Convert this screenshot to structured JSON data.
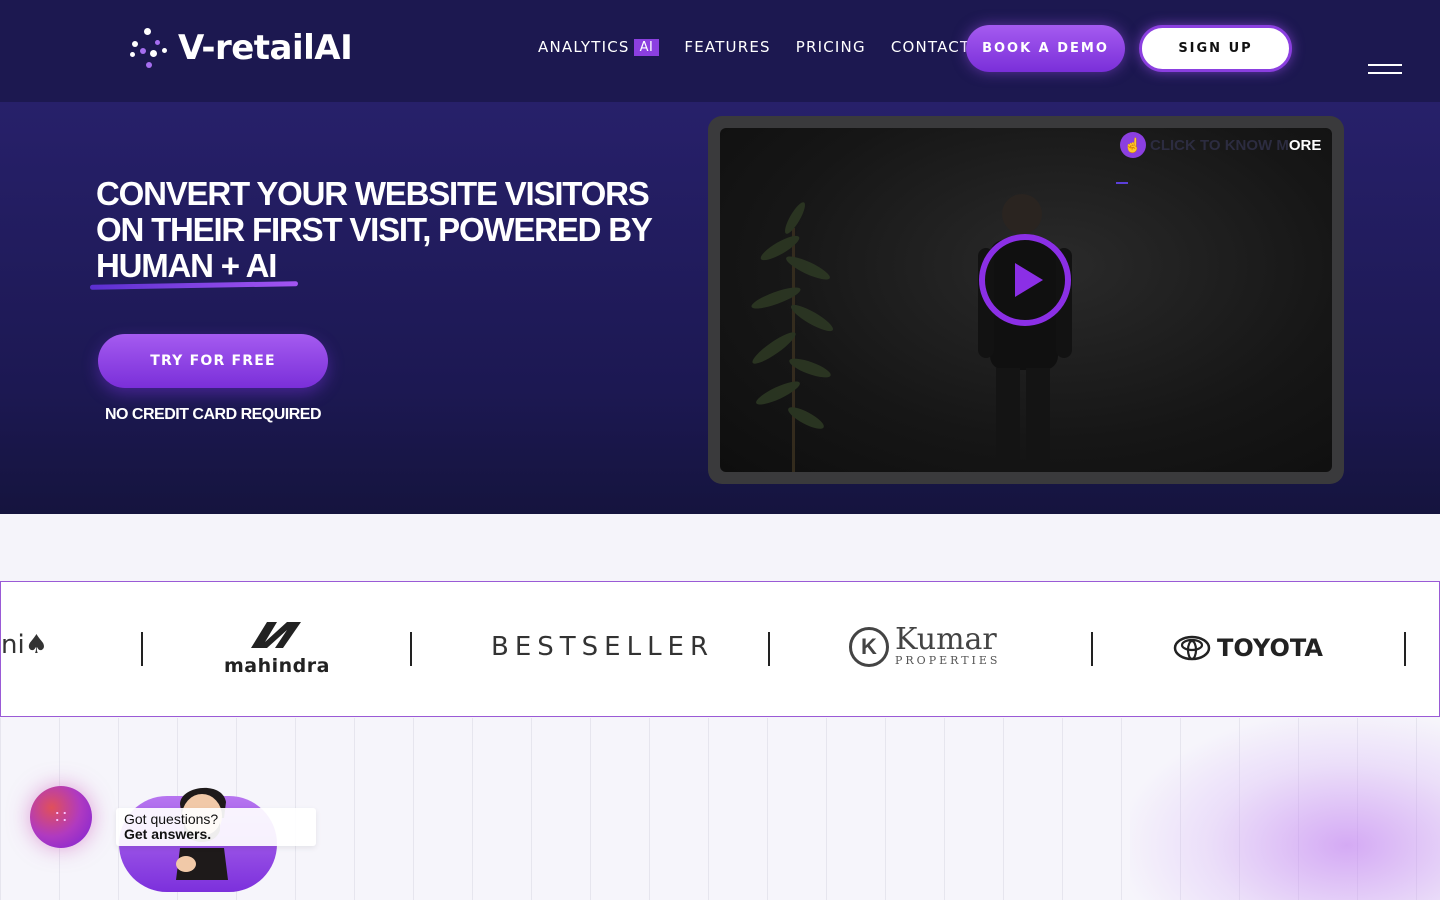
{
  "nav": {
    "logo_text": "V-retailAI",
    "links": [
      {
        "label": "ANALYTICS",
        "badge": "AI"
      },
      {
        "label": "FEATURES"
      },
      {
        "label": "PRICING"
      },
      {
        "label": "CONTACT"
      }
    ],
    "book_demo_label": "BOOK A DEMO",
    "sign_up_label": "SIGN UP"
  },
  "hero": {
    "headline_plain": "CONVERT YOUR WEBSITE VISITORS ON THEIR FIRST VISIT, POWERED BY ",
    "headline_highlight": "HUMAN + AI",
    "cta_label": "TRY FOR FREE",
    "cta_note": "NO CREDIT CARD REQUIRED",
    "video": {
      "overlay_faded": "CLICK TO KNOW M",
      "overlay_visible": "ORE"
    }
  },
  "brands": {
    "partial": "ni",
    "items": [
      "mahindra",
      "BESTSELLER",
      "Kumar",
      "PROPERTIES",
      "TOYOTA"
    ]
  },
  "chat": {
    "line1": "Got questions?",
    "line2": "Get answers."
  },
  "colors": {
    "nav_bg": "#1c1850",
    "accent": "#8b3fe0",
    "hero_bg": "#27206a"
  }
}
